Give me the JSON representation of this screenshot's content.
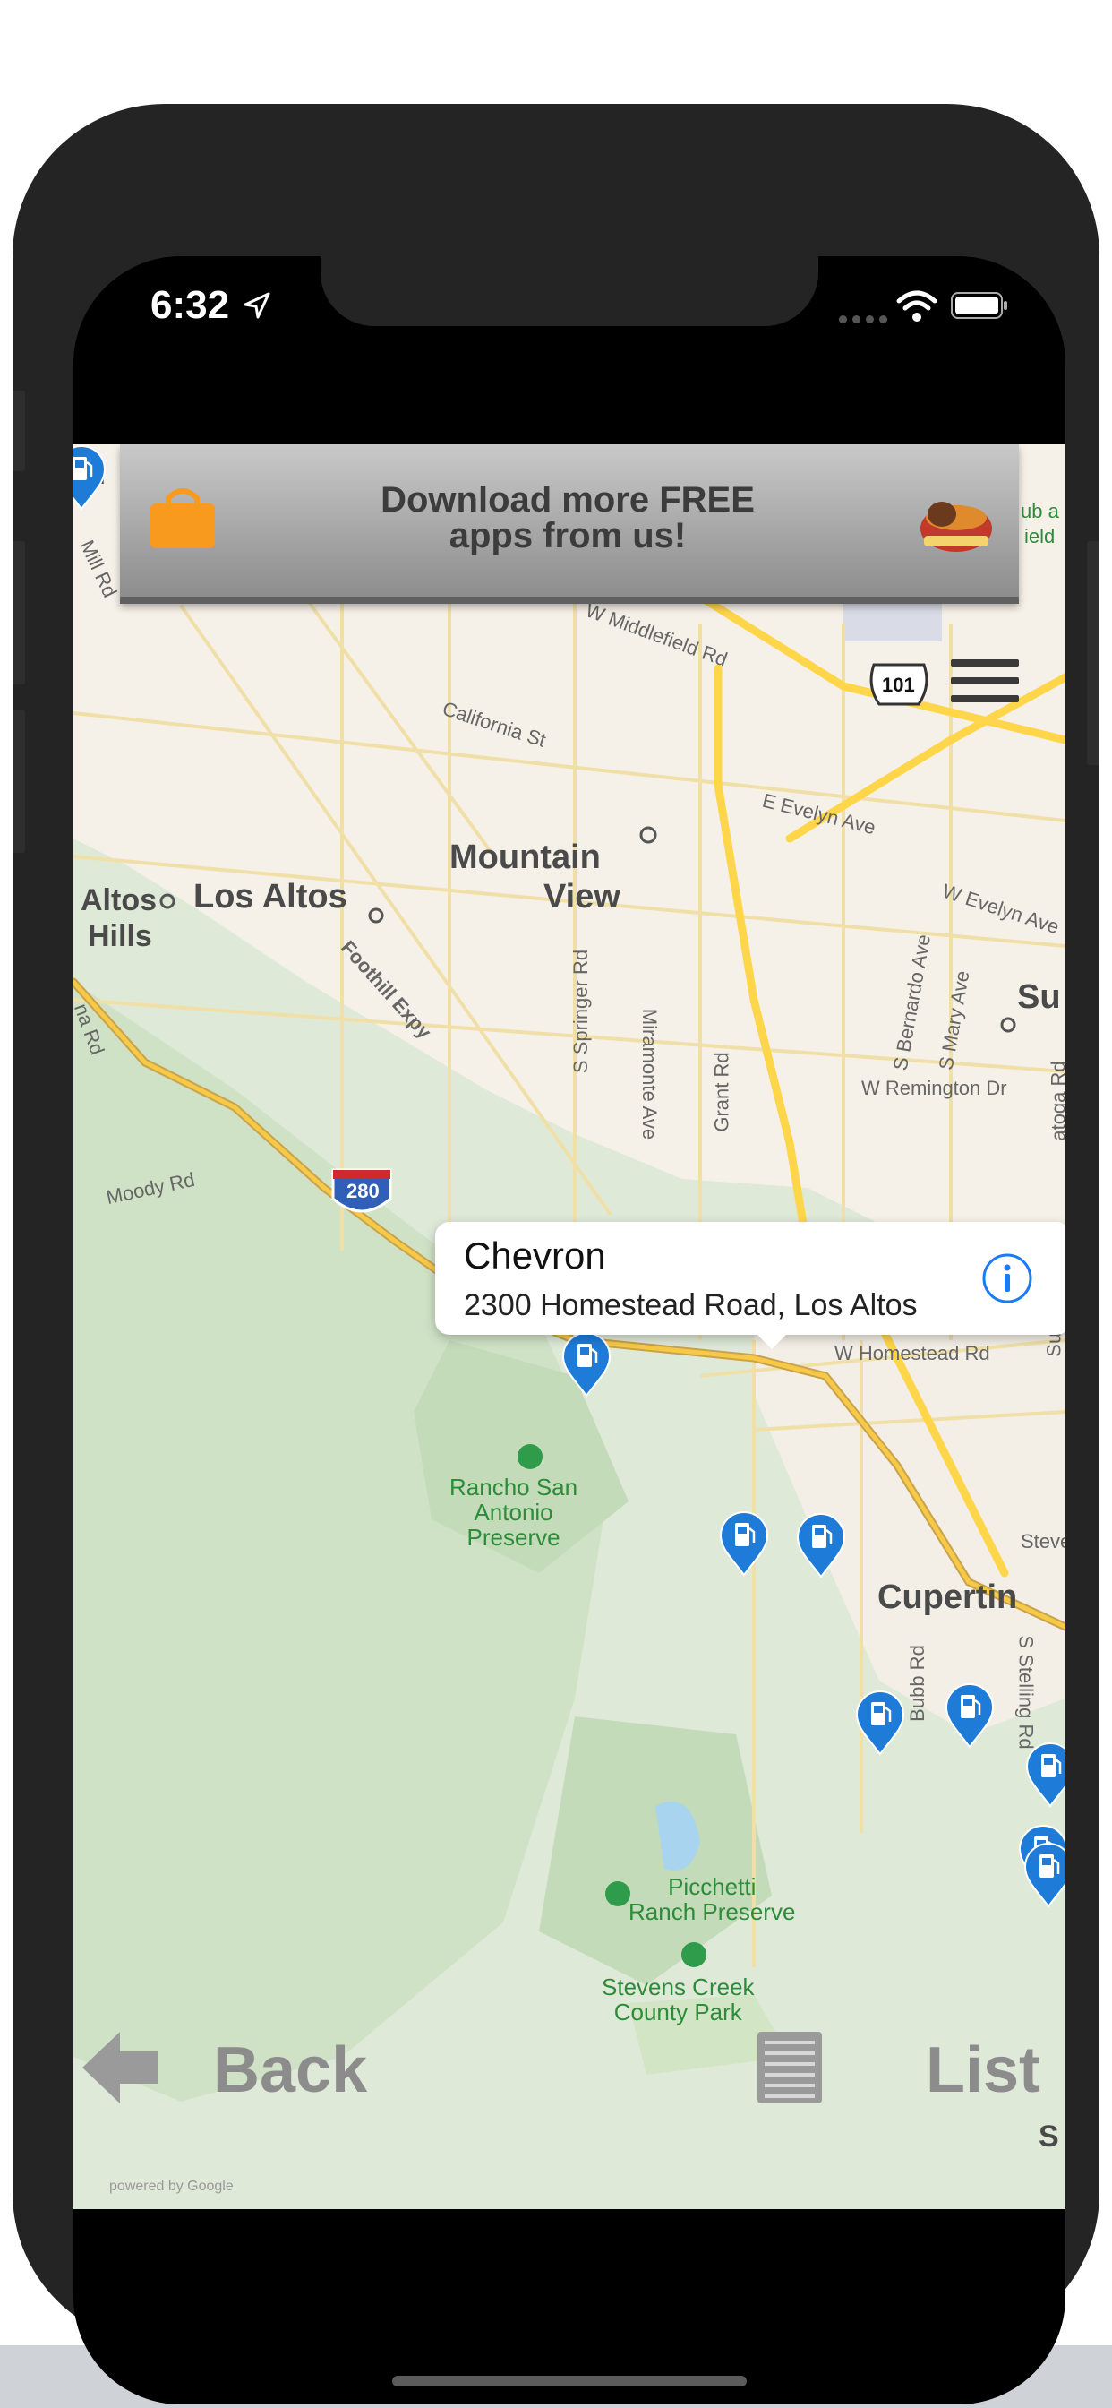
{
  "status_bar": {
    "time": "6:32"
  },
  "ad_banner": {
    "line1": "Download more FREE",
    "line2": "apps from us!"
  },
  "map": {
    "cities": {
      "mountain_view_1": "Mountain",
      "mountain_view_2": "View",
      "los_altos": "Los Altos",
      "altos_hills_1": "Altos",
      "altos_hills_2": "Hills",
      "cupertino": "Cupertin",
      "sunnyvale": "Su",
      "top_left": "rd",
      "bottom_right": "S"
    },
    "streets": {
      "middlefield": "W Middlefield Rd",
      "california": "California St",
      "evelyn": "E Evelyn Ave",
      "w_evelyn": "W Evelyn Ave",
      "foothill": "Foothill Expy",
      "springer": "S Springer Rd",
      "miramonte": "Miramonte Ave",
      "grant": "Grant Rd",
      "bernardo": "S Bernardo Ave",
      "mary": "S Mary Ave",
      "remington": "W Remington Dr",
      "moody": "Moody Rd",
      "homestead": "W Homestead Rd",
      "bubb": "Bubb Rd",
      "stelling": "S Stelling Rd",
      "steve": "Steve",
      "mill": "Mill Rd",
      "na": "na Rd",
      "hub": "ub a",
      "ield": "ield",
      "atoga": "atoga Rd",
      "sunn": "Sunn"
    },
    "highways": {
      "i280": "280",
      "us101": "101"
    },
    "parks": {
      "rancho": "Rancho San\nAntonio\nPreserve",
      "picchetti": "Picchetti\nRanch Preserve",
      "stevens": "Stevens Creek\nCounty Park"
    },
    "powered_by": "powered by Google"
  },
  "callout": {
    "title": "Chevron",
    "address": "2300 Homestead Road, Los Altos"
  },
  "controls": {
    "back_label": "Back",
    "list_label": "List"
  },
  "colors": {
    "pin": "#1e7bd8",
    "highway": "#f5cc3a",
    "info": "#1a7cf5"
  }
}
